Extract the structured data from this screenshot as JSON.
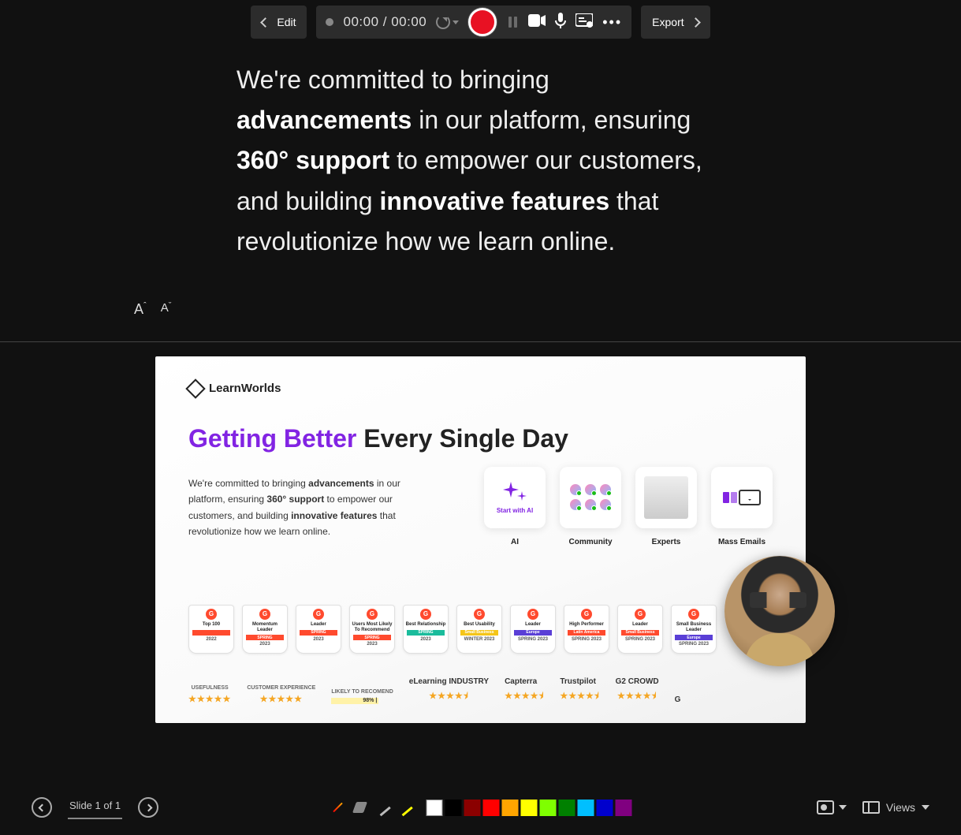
{
  "toolbar": {
    "edit_label": "Edit",
    "timer": "00:00 / 00:00",
    "export_label": "Export"
  },
  "prompter": {
    "p1a": "We're committed to bringing ",
    "p1b": "advancements",
    "p2a": " in our platform, ensuring ",
    "p2b": "360° support",
    "p2c": " to empower our customers, and building ",
    "p3a": "innovative features",
    "p3b": " that revolutionize how we learn online."
  },
  "slide": {
    "logo": "LearnWorlds",
    "headline_a": "Getting Better",
    "headline_b": "Every Single Day",
    "body_1": "We're committed to bringing ",
    "body_2": "advancements",
    "body_3": " in our platform, ensuring ",
    "body_4": "360° support",
    "body_5": " to empower our customers, and building ",
    "body_6": "innovative features",
    "body_7": " that revolutionize how we learn online.",
    "features": [
      {
        "label": "AI",
        "card_text": "Start with AI"
      },
      {
        "label": "Community",
        "card_text": ""
      },
      {
        "label": "Experts",
        "card_text": ""
      },
      {
        "label": "Mass Emails",
        "card_text": ""
      }
    ],
    "badges": [
      {
        "title": "Top 100",
        "stripe": "",
        "stripe_color": "#ff4a2e",
        "year": "2022"
      },
      {
        "title": "Momentum Leader",
        "stripe": "SPRING",
        "stripe_color": "#ff4a2e",
        "year": "2023"
      },
      {
        "title": "Leader",
        "stripe": "SPRING",
        "stripe_color": "#ff4a2e",
        "year": "2023"
      },
      {
        "title": "Users Most Likely To Recommend",
        "stripe": "SPRING",
        "stripe_color": "#ff4a2e",
        "year": "2023"
      },
      {
        "title": "Best Relationship",
        "stripe": "SPRING",
        "stripe_color": "#1abc9c",
        "year": "2023"
      },
      {
        "title": "Best Usability",
        "stripe": "Small Business",
        "stripe_color": "#f5c518",
        "year": "WINTER 2023"
      },
      {
        "title": "Leader",
        "stripe": "Europe",
        "stripe_color": "#5a3fd6",
        "year": "SPRING 2023"
      },
      {
        "title": "High Performer",
        "stripe": "Latin America",
        "stripe_color": "#ff4a2e",
        "year": "SPRING 2023"
      },
      {
        "title": "Leader",
        "stripe": "Small Business",
        "stripe_color": "#ff4a2e",
        "year": "SPRING 2023"
      },
      {
        "title": "Small Business Leader",
        "stripe": "Europe",
        "stripe_color": "#5a3fd6",
        "year": "SPRING 2023"
      }
    ],
    "ratings": [
      {
        "label": "USEFULNESS",
        "stars": "★★★★★"
      },
      {
        "label": "CUSTOMER EXPERIENCE",
        "stars": "★★★★★"
      },
      {
        "label": "LIKELY TO RECOMEND",
        "bar": "98%"
      },
      {
        "logo": "eLearning INDUSTRY",
        "stars": "★★★★⯨"
      },
      {
        "logo": "Capterra",
        "stars": "★★★★⯨"
      },
      {
        "logo": "Trustpilot",
        "stars": "★★★★⯨"
      },
      {
        "logo": "G2 CROWD",
        "stars": "★★★★⯨"
      },
      {
        "logo": "G",
        "stars": ""
      }
    ]
  },
  "bottombar": {
    "slide_indicator": "Slide 1 of 1",
    "views_label": "Views",
    "swatches": [
      "#ffffff",
      "#000000",
      "#8b0000",
      "#ff0000",
      "#ffa500",
      "#ffff00",
      "#7fff00",
      "#008000",
      "#00bfff",
      "#0000cd",
      "#800080"
    ]
  }
}
